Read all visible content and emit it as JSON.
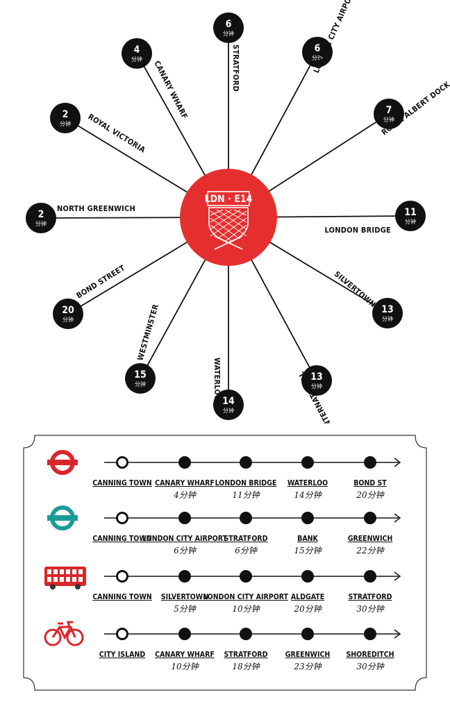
{
  "hub": {
    "label": "LDN · E14",
    "color": "#e52f2f"
  },
  "spokes": [
    {
      "name": "STRATFORD",
      "minutes": "6",
      "unit": "分钟"
    },
    {
      "name": "LONDON CITY AIRPORT",
      "minutes": "6",
      "unit": "分钟"
    },
    {
      "name": "ROYAL ALBERT DOCK",
      "minutes": "7",
      "unit": "分钟"
    },
    {
      "name": "LONDON BRIDGE",
      "minutes": "11",
      "unit": "分钟"
    },
    {
      "name": "SILVERTOWN",
      "minutes": "13",
      "unit": "分钟"
    },
    {
      "name": "STRATFORD INTERNATIONAL",
      "minutes": "13",
      "unit": "分钟"
    },
    {
      "name": "WATERLOO",
      "minutes": "14",
      "unit": "分钟"
    },
    {
      "name": "WESTMINSTER",
      "minutes": "15",
      "unit": "分钟"
    },
    {
      "name": "BOND STREET",
      "minutes": "20",
      "unit": "分钟"
    },
    {
      "name": "NORTH GREENWICH",
      "minutes": "2",
      "unit": "分钟"
    },
    {
      "name": "ROYAL VICTORIA",
      "minutes": "2",
      "unit": "分钟"
    },
    {
      "name": "CANARY WHARF",
      "minutes": "4",
      "unit": "分钟"
    }
  ],
  "routes": [
    {
      "mode_icon": "underground-roundel-icon",
      "color": "#d9262a",
      "stops": [
        {
          "name": "CANNING TOWN",
          "time": ""
        },
        {
          "name": "CANARY WHARF",
          "time": "4分钟"
        },
        {
          "name": "LONDON BRIDGE",
          "time": "11分钟"
        },
        {
          "name": "WATERLOO",
          "time": "14分钟"
        },
        {
          "name": "BOND ST",
          "time": "20分钟"
        }
      ]
    },
    {
      "mode_icon": "dlr-roundel-icon",
      "color": "#1b9b98",
      "stops": [
        {
          "name": "CANNING TOWN",
          "time": ""
        },
        {
          "name": "LONDON CITY AIRPORT",
          "time": "6分钟"
        },
        {
          "name": "STRATFORD",
          "time": "6分钟"
        },
        {
          "name": "BANK",
          "time": "15分钟"
        },
        {
          "name": "GREENWICH",
          "time": "22分钟"
        }
      ]
    },
    {
      "mode_icon": "double-decker-bus-icon",
      "color": "#d9262a",
      "stops": [
        {
          "name": "CANNING TOWN",
          "time": ""
        },
        {
          "name": "SILVERTOWN",
          "time": "5分钟"
        },
        {
          "name": "LONDON CITY AIRPORT",
          "time": "10分钟"
        },
        {
          "name": "ALDGATE",
          "time": "20分钟"
        },
        {
          "name": "STRATFORD",
          "time": "30分钟"
        }
      ]
    },
    {
      "mode_icon": "bicycle-icon",
      "color": "#d9262a",
      "stops": [
        {
          "name": "CITY ISLAND",
          "time": ""
        },
        {
          "name": "CANARY WHARF",
          "time": "10分钟"
        },
        {
          "name": "STRATFORD",
          "time": "18分钟"
        },
        {
          "name": "GREENWICH",
          "time": "23分钟"
        },
        {
          "name": "SHOREDITCH",
          "time": "30分钟"
        }
      ]
    }
  ]
}
